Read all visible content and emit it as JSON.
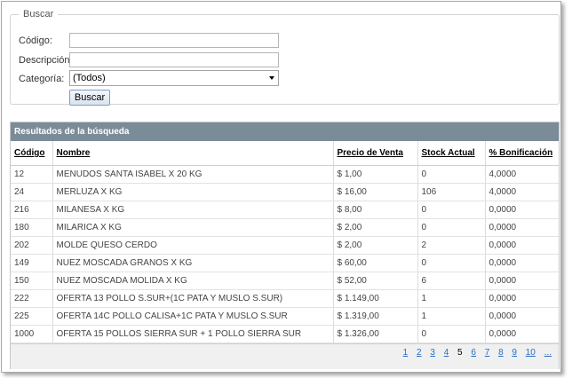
{
  "search": {
    "legend": "Buscar",
    "codigo_label": "Código:",
    "codigo_value": "",
    "descripcion_label": "Descripción:",
    "descripcion_value": "",
    "categoria_label": "Categoría:",
    "categoria_value": "(Todos)",
    "button_label": "Buscar"
  },
  "results": {
    "title": "Resultados de la búsqueda",
    "columns": [
      "Código",
      "Nombre",
      "Precio de Venta",
      "Stock Actual",
      "% Bonificación"
    ],
    "rows": [
      [
        "12",
        "MENUDOS SANTA ISABEL X 20 KG",
        "$ 1,00",
        "0",
        "4,0000"
      ],
      [
        "24",
        "MERLUZA X KG",
        "$ 16,00",
        "106",
        "4,0000"
      ],
      [
        "216",
        "MILANESA X KG",
        "$ 8,00",
        "0",
        "0,0000"
      ],
      [
        "180",
        "MILARICA X KG",
        "$ 2,00",
        "0",
        "0,0000"
      ],
      [
        "202",
        "MOLDE QUESO CERDO",
        "$ 2,00",
        "2",
        "0,0000"
      ],
      [
        "149",
        "NUEZ MOSCADA GRANOS X KG",
        "$ 60,00",
        "0",
        "0,0000"
      ],
      [
        "150",
        "NUEZ MOSCADA MOLIDA X KG",
        "$ 52,00",
        "6",
        "0,0000"
      ],
      [
        "222",
        "OFERTA 13 POLLO S.SUR+(1C PATA Y MUSLO S.SUR)",
        "$ 1.149,00",
        "1",
        "0,0000"
      ],
      [
        "225",
        "OFERTA 14C POLLO CALISA+1C PATA Y MUSLO S.SUR",
        "$ 1.319,00",
        "1",
        "0,0000"
      ],
      [
        "1000",
        "OFERTA 15 POLLOS SIERRA SUR + 1 POLLO SIERRA SUR",
        "$ 1.326,00",
        "0",
        "0,0000"
      ]
    ],
    "pager": [
      "1",
      "2",
      "3",
      "4",
      "5",
      "6",
      "7",
      "8",
      "9",
      "10",
      "..."
    ],
    "current_page": "5"
  }
}
